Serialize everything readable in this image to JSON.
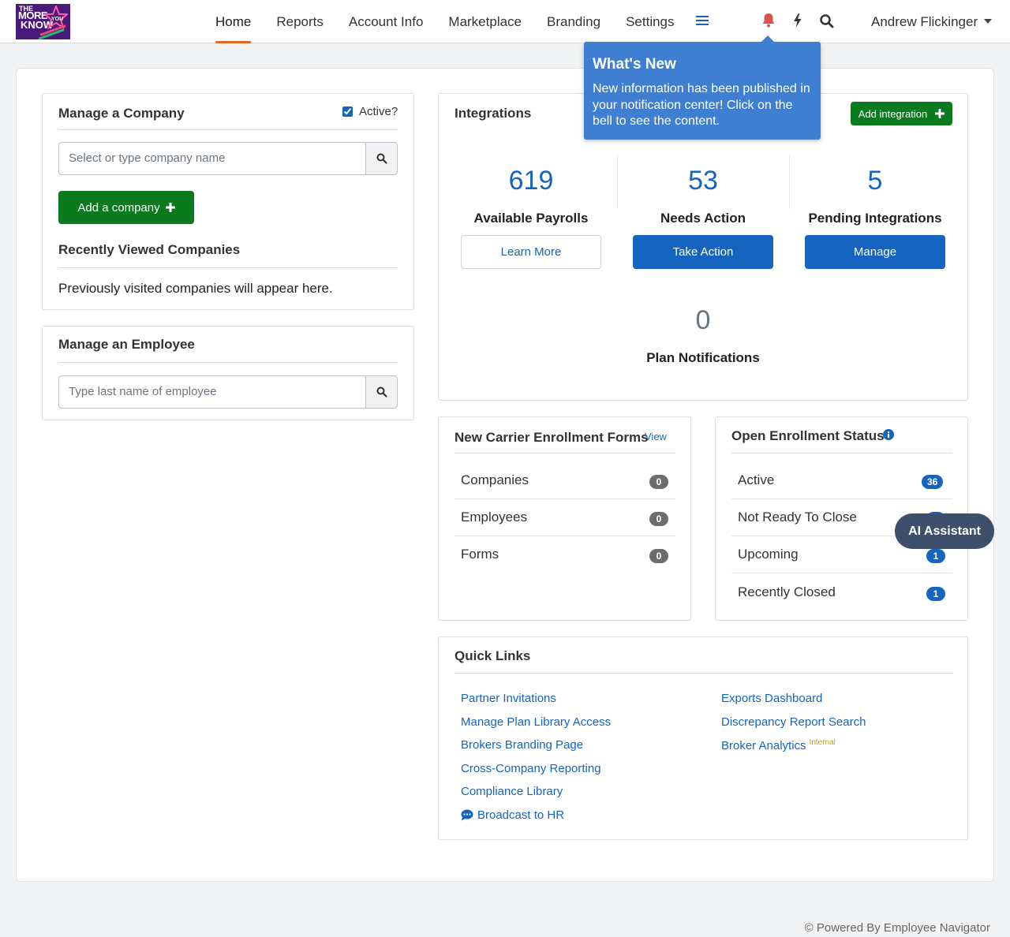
{
  "brand": {
    "logo_text_1": "THE",
    "logo_text_2": "MORE",
    "logo_text_3": "KNOW",
    "logo_text_4": "YOU"
  },
  "nav": {
    "items": [
      {
        "label": "Home",
        "active": true
      },
      {
        "label": "Reports"
      },
      {
        "label": "Account Info"
      },
      {
        "label": "Marketplace"
      },
      {
        "label": "Branding"
      },
      {
        "label": "Settings"
      }
    ],
    "user_name": "Andrew Flickinger"
  },
  "colors": {
    "accent": "#1565c0",
    "green": "#0a7a1e",
    "active_underline": "#e2681e",
    "bell": "#d9534f"
  },
  "manage_company": {
    "title": "Manage a Company",
    "active_label": "Active?",
    "active_checked": true,
    "search_placeholder": "Select or type company name",
    "add_button": "Add a company",
    "recent_title": "Recently Viewed Companies",
    "recent_empty": "Previously visited companies will appear here."
  },
  "manage_employee": {
    "title": "Manage an Employee",
    "search_placeholder": "Type last name of employee"
  },
  "integrations": {
    "title": "Integrations",
    "add_button": "Add integration",
    "stats": [
      {
        "value": "619",
        "label": "Available Payrolls",
        "button": "Learn More"
      },
      {
        "value": "53",
        "label": "Needs Action",
        "button": "Take Action"
      },
      {
        "value": "5",
        "label": "Pending Integrations",
        "button": "Manage"
      }
    ],
    "plan_notifications": {
      "value": "0",
      "label": "Plan Notifications"
    }
  },
  "carrier_forms": {
    "title": "New Carrier Enrollment Forms",
    "view_link": "View",
    "rows": [
      {
        "label": "Companies",
        "count": "0"
      },
      {
        "label": "Employees",
        "count": "0"
      },
      {
        "label": "Forms",
        "count": "0"
      }
    ]
  },
  "open_enrollment": {
    "title": "Open Enrollment Status",
    "rows": [
      {
        "label": "Active",
        "count": "36"
      },
      {
        "label": "Not Ready To Close",
        "count": ""
      },
      {
        "label": "Upcoming",
        "count": "1"
      },
      {
        "label": "Recently Closed",
        "count": "1"
      }
    ]
  },
  "quick_links": {
    "title": "Quick Links",
    "left": [
      "Partner Invitations",
      "Manage Plan Library Access",
      "Brokers Branding Page",
      "Cross-Company Reporting",
      "Compliance Library",
      "Broadcast to HR"
    ],
    "right": [
      "Exports Dashboard",
      "Discrepancy Report Search",
      "Broker Analytics"
    ],
    "internal_tag": "Internal"
  },
  "popover": {
    "title": "What's New",
    "body": "New information has been published in your notification center! Click on the bell to see the content."
  },
  "ai_assistant": "AI Assistant",
  "footer": "© Powered By Employee Navigator"
}
